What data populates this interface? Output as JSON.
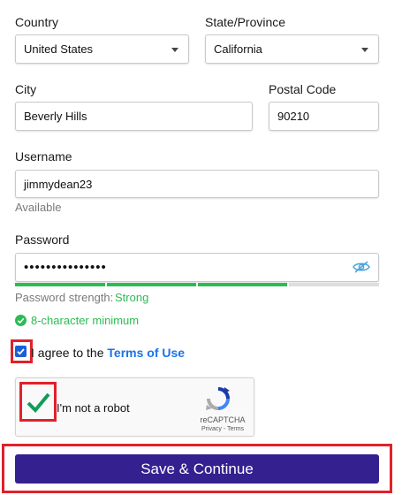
{
  "country": {
    "label": "Country",
    "value": "United States"
  },
  "state": {
    "label": "State/Province",
    "value": "California"
  },
  "city": {
    "label": "City",
    "value": "Beverly Hills"
  },
  "postal": {
    "label": "Postal Code",
    "value": "90210"
  },
  "username": {
    "label": "Username",
    "value": "jimmydean23",
    "status": "Available"
  },
  "password": {
    "label": "Password",
    "value": "•••••••••••••••",
    "strength_label": "Password strength:",
    "strength_value": "Strong",
    "strength_fraction": 0.75,
    "rule": "8-character minimum"
  },
  "terms": {
    "prefix": "I agree to the",
    "link": "Terms of Use",
    "checked": true
  },
  "captcha": {
    "text": "I'm not a robot",
    "brand": "reCAPTCHA",
    "links": "Privacy - Terms",
    "checked": true
  },
  "submit": {
    "label": "Save & Continue"
  },
  "colors": {
    "accent_green": "#2dbb54",
    "link_blue": "#1a73e8",
    "button_purple": "#34208f",
    "highlight_red": "#e0212b",
    "checkbox_blue": "#1a5fd6"
  }
}
